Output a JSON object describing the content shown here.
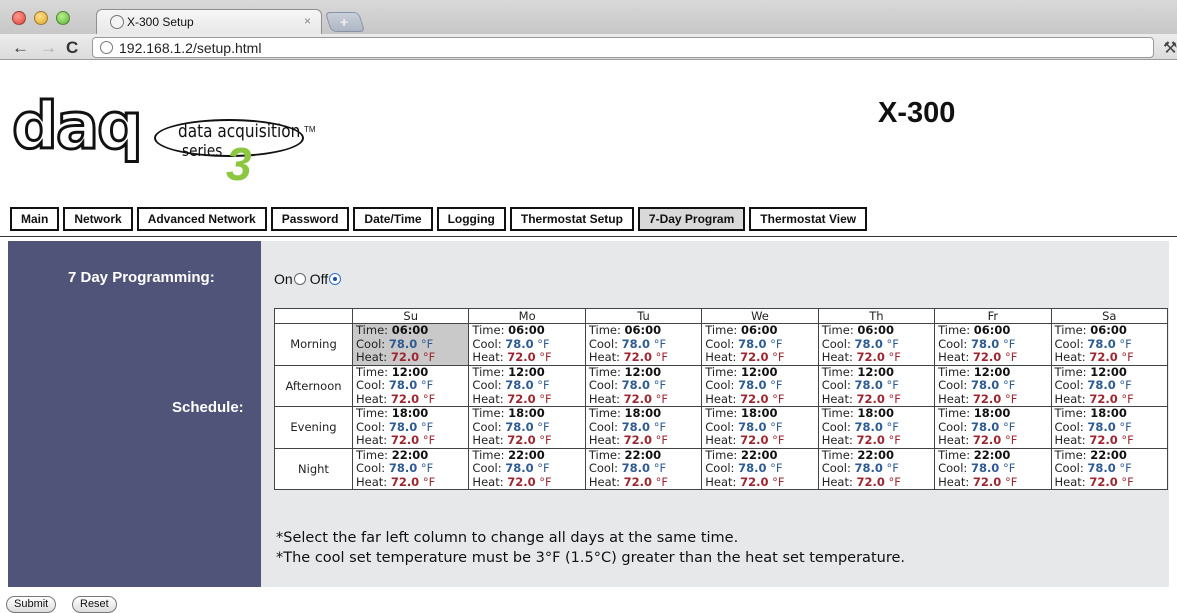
{
  "browser": {
    "tab_title": "X-300 Setup",
    "tab_close": "×",
    "new_tab": "+",
    "url": "192.168.1.2/setup.html",
    "back": "←",
    "forward": "→",
    "reload": "C",
    "wrench": "🔧"
  },
  "logo": {
    "word": "daq",
    "line1": "data acquisition",
    "line2": "series",
    "tm": "TM",
    "number": "3"
  },
  "page_title": "X-300",
  "nav": {
    "tabs": [
      "Main",
      "Network",
      "Advanced Network",
      "Password",
      "Date/Time",
      "Logging",
      "Thermostat Setup",
      "7-Day Program",
      "Thermostat View"
    ],
    "active": "7-Day Program"
  },
  "programming": {
    "label": "7 Day Programming:",
    "on_label": "On",
    "off_label": "Off",
    "selected": "Off"
  },
  "schedule": {
    "label": "Schedule:",
    "days": [
      "Su",
      "Mo",
      "Tu",
      "We",
      "Th",
      "Fr",
      "Sa"
    ],
    "prefix_time": "Time: ",
    "prefix_cool": "Cool: ",
    "prefix_heat": "Heat: ",
    "unit": " °F",
    "rows": [
      {
        "period": "Morning",
        "time": "06:00",
        "cool": "78.0",
        "heat": "72.0"
      },
      {
        "period": "Afternoon",
        "time": "12:00",
        "cool": "78.0",
        "heat": "72.0"
      },
      {
        "period": "Evening",
        "time": "18:00",
        "cool": "78.0",
        "heat": "72.0"
      },
      {
        "period": "Night",
        "time": "22:00",
        "cool": "78.0",
        "heat": "72.0"
      }
    ],
    "selected_cell": {
      "row": 0,
      "day": 0
    }
  },
  "notes": {
    "note1": "*Select the far left column to change all days at the same time.",
    "note2": "*The cool set temperature must be 3°F (1.5°C) greater than the heat set temperature."
  },
  "buttons": {
    "submit": "Submit",
    "reset": "Reset"
  },
  "colors": {
    "panel": "#4f5478",
    "cool_value": "#2e5b92",
    "heat_value": "#9d2630",
    "logo_accent": "#8dc63f"
  }
}
